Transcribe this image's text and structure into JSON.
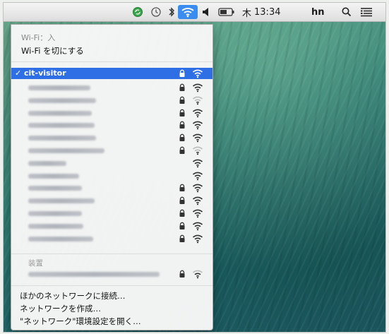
{
  "menubar": {
    "day": "木",
    "time": "13:34",
    "user": "hn",
    "icons": [
      "sync-icon",
      "time-machine-icon",
      "bluetooth-icon",
      "wifi-icon",
      "volume-icon",
      "battery-icon",
      "search-icon",
      "list-icon"
    ]
  },
  "wifi_menu": {
    "status": "Wi-Fi：入",
    "toggle_label": "Wi-Fi を切にする",
    "selected_network": "cit-visitor",
    "check": "✓",
    "networks": [
      {
        "locked": true
      },
      {
        "locked": true
      },
      {
        "locked": true
      },
      {
        "locked": true
      },
      {
        "locked": true
      },
      {
        "locked": true
      },
      {
        "locked": false
      },
      {
        "locked": false
      },
      {
        "locked": true
      },
      {
        "locked": true
      },
      {
        "locked": true
      },
      {
        "locked": true
      },
      {
        "locked": true
      }
    ],
    "devices_label": "装置",
    "device_network": {
      "locked": true
    },
    "join_other": "ほかのネットワークに接続…",
    "create_network": "ネットワークを作成…",
    "open_prefs": "\"ネットワーク\"環境設定を開く…"
  },
  "colors": {
    "selection": "#2f6fe6",
    "menubar_wifi_highlight": "#3b8cf0"
  }
}
